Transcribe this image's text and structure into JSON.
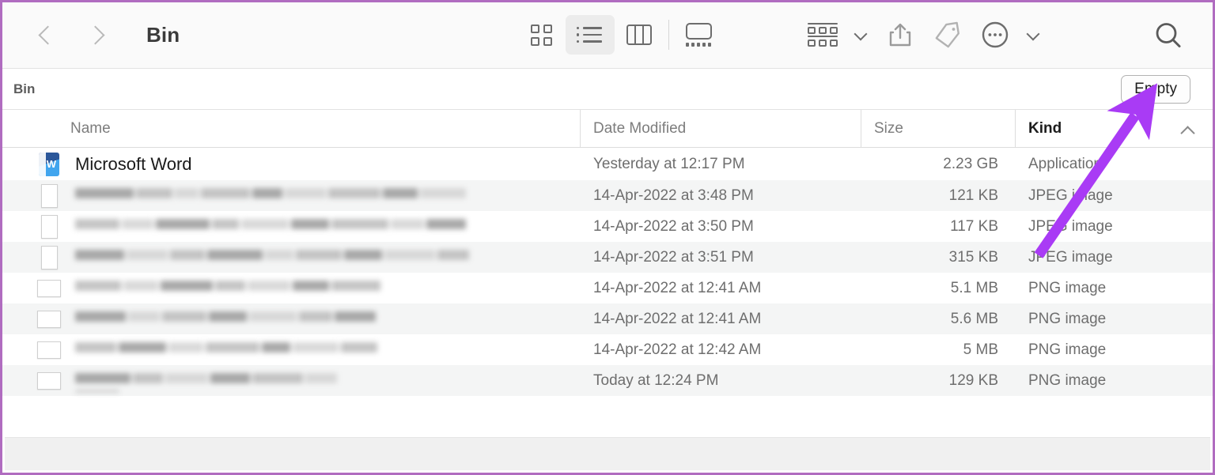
{
  "window": {
    "title": "Bin",
    "frame_accent": "#b06cc0"
  },
  "toolbar": {
    "back_label": "Back",
    "forward_label": "Forward",
    "view_modes": [
      {
        "name": "icon-view",
        "label": "Icon View",
        "active": false
      },
      {
        "name": "list-view",
        "label": "List View",
        "active": true
      },
      {
        "name": "column-view",
        "label": "Column View",
        "active": false
      },
      {
        "name": "gallery-view",
        "label": "Gallery View",
        "active": false
      }
    ],
    "group_label": "Group",
    "share_label": "Share",
    "tag_label": "Tags",
    "more_label": "More",
    "search_label": "Search"
  },
  "subbar": {
    "title": "Bin",
    "empty_label": "Empty"
  },
  "columns": {
    "name": "Name",
    "date_modified": "Date Modified",
    "size": "Size",
    "kind": "Kind",
    "sort_column": "Kind",
    "sort_direction": "ascending"
  },
  "files": [
    {
      "name": "Microsoft Word",
      "redacted": false,
      "icon": "word-app-icon",
      "date": "Yesterday at 12:17 PM",
      "size": "2.23 GB",
      "kind": "Application"
    },
    {
      "name": "",
      "redacted": true,
      "icon": "image-thumbnail-portrait",
      "date": "14-Apr-2022 at 3:48 PM",
      "size": "121 KB",
      "kind": "JPEG image"
    },
    {
      "name": "",
      "redacted": true,
      "icon": "image-thumbnail-portrait",
      "date": "14-Apr-2022 at 3:50 PM",
      "size": "117 KB",
      "kind": "JPEG image"
    },
    {
      "name": "",
      "redacted": true,
      "icon": "image-thumbnail-portrait",
      "date": "14-Apr-2022 at 3:51 PM",
      "size": "315 KB",
      "kind": "JPEG image"
    },
    {
      "name": "",
      "redacted": true,
      "icon": "image-thumbnail-landscape",
      "date": "14-Apr-2022 at 12:41 AM",
      "size": "5.1 MB",
      "kind": "PNG image"
    },
    {
      "name": "",
      "redacted": true,
      "icon": "image-thumbnail-landscape",
      "date": "14-Apr-2022 at 12:41 AM",
      "size": "5.6 MB",
      "kind": "PNG image"
    },
    {
      "name": "",
      "redacted": true,
      "icon": "image-thumbnail-landscape",
      "date": "14-Apr-2022 at 12:42 AM",
      "size": "5 MB",
      "kind": "PNG image"
    },
    {
      "name": "",
      "redacted": true,
      "icon": "image-thumbnail-landscape",
      "date": "Today at 12:24 PM",
      "size": "129 KB",
      "kind": "PNG image"
    }
  ],
  "annotation": {
    "arrow_color": "#a93bf5",
    "points_at": "Empty"
  }
}
